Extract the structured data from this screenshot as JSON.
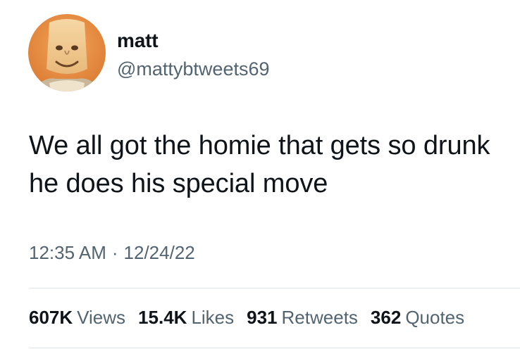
{
  "author": {
    "display_name": "matt",
    "handle": "@mattybtweets69",
    "avatar_icon": "cartoon-face-avatar"
  },
  "tweet": {
    "text": "We all got the homie that gets so drunk he does his special move",
    "time": "12:35 AM",
    "separator": "·",
    "date": "12/24/22"
  },
  "stats": {
    "views_count": "607K",
    "views_label": "Views",
    "likes_count": "15.4K",
    "likes_label": "Likes",
    "retweets_count": "931",
    "retweets_label": "Retweets",
    "quotes_count": "362",
    "quotes_label": "Quotes"
  },
  "colors": {
    "primary_text": "#0f1419",
    "secondary_text": "#536471",
    "divider": "#e1e6ea",
    "background": "#ffffff"
  }
}
